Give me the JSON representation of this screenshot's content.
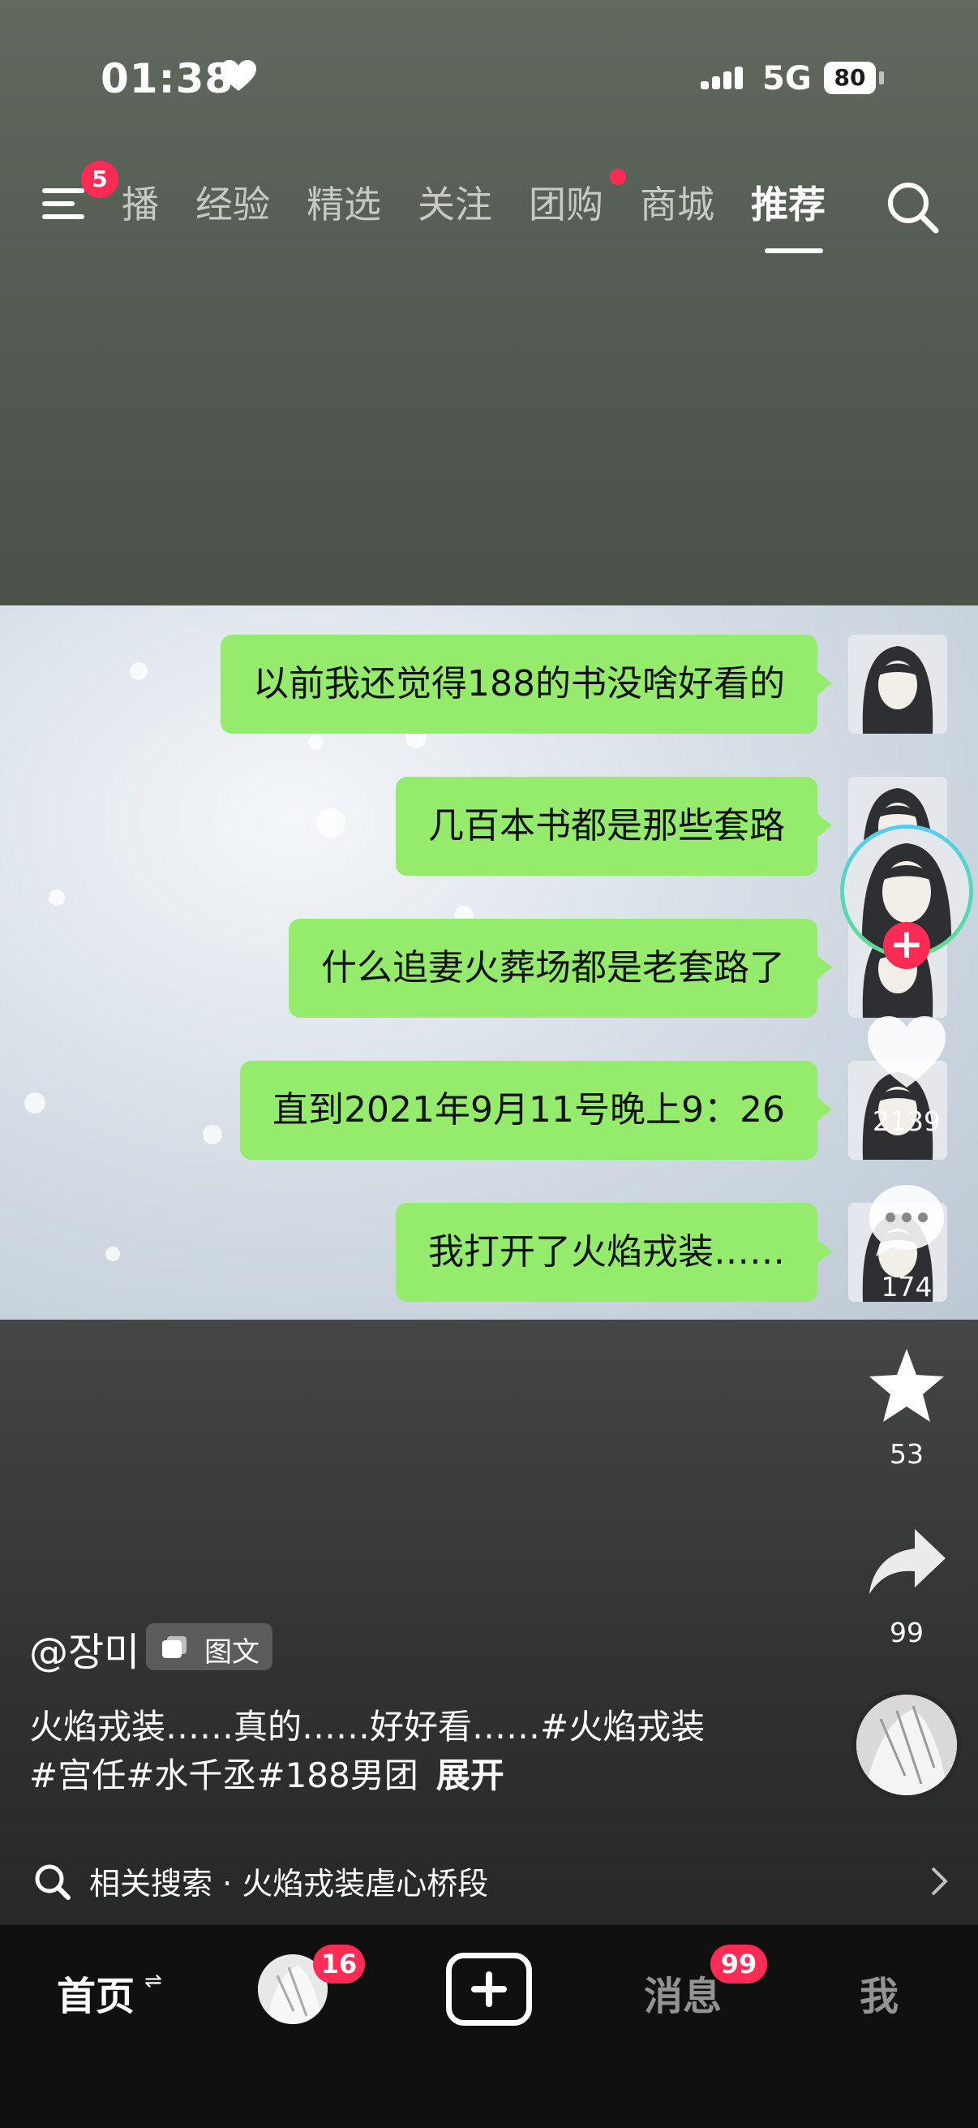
{
  "status_bar": {
    "time": "01:38",
    "network": "5G",
    "battery": "80"
  },
  "top_nav": {
    "menu_badge": "5",
    "tabs": [
      "播",
      "经验",
      "精选",
      "关注",
      "团购",
      "商城",
      "推荐"
    ],
    "active_tab": "推荐"
  },
  "post": {
    "messages": [
      "以前我还觉得188的书没啥好看的",
      "几百本书都是那些套路",
      "什么追妻火葬场都是老套路了",
      "直到2021年9月11号晚上9：26",
      "我打开了火焰戎装……"
    ],
    "author": "@장미",
    "type_tag": "图文",
    "caption": "火焰戎装……真的……好好看……#火焰戎装 #宫任#水千丞#188男团",
    "expand_label": "展开"
  },
  "actions": {
    "likes": "2139",
    "comments": "174",
    "favorites": "53",
    "shares": "99"
  },
  "related_search": {
    "prefix": "相关搜索",
    "separator": " · ",
    "query": "火焰戎装虐心桥段"
  },
  "tab_bar": {
    "home": "首页",
    "friends_badge": "16",
    "messages": "消息",
    "messages_badge": "99",
    "me": "我"
  },
  "icons": [
    "heart-icon",
    "signal-icon",
    "battery-icon",
    "menu-icon",
    "search-icon",
    "like-icon",
    "comment-icon",
    "star-icon",
    "share-icon",
    "plus-icon",
    "chevron-right-icon"
  ],
  "colors": {
    "accent": "#fe2c55",
    "chat_bubble": "#95eb6b",
    "tab_bar": "#101010"
  }
}
